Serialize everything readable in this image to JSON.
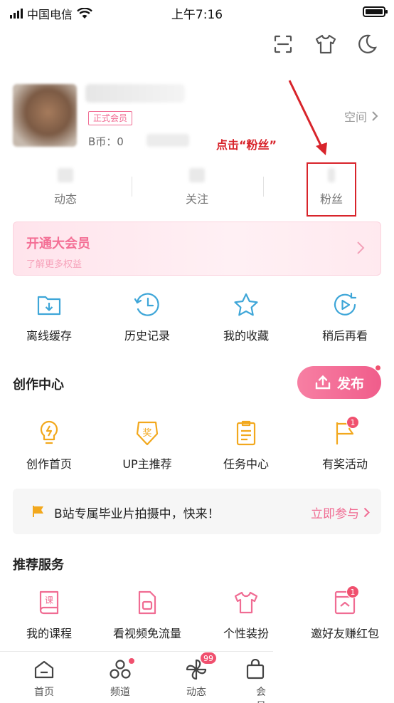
{
  "status_bar": {
    "carrier": "中国电信",
    "time": "上午7:16"
  },
  "profile": {
    "member_badge": "正式会员",
    "bcoin": "B币：0",
    "space_link": "空间"
  },
  "annotation": "点击“粉丝”",
  "stats": [
    {
      "label": "动态"
    },
    {
      "label": "关注"
    },
    {
      "label": "粉丝"
    }
  ],
  "vip": {
    "title": "开通大会员",
    "subtitle": "了解更多权益"
  },
  "quick_actions": [
    {
      "label": "离线缓存",
      "icon": "download-folder-icon"
    },
    {
      "label": "历史记录",
      "icon": "history-clock-icon"
    },
    {
      "label": "我的收藏",
      "icon": "star-icon"
    },
    {
      "label": "稍后再看",
      "icon": "watch-later-icon"
    }
  ],
  "creation": {
    "title": "创作中心",
    "publish": "发布",
    "items": [
      {
        "label": "创作首页",
        "icon": "lightbulb-icon"
      },
      {
        "label": "UP主推荐",
        "icon": "award-badge-icon"
      },
      {
        "label": "任务中心",
        "icon": "task-clipboard-icon"
      },
      {
        "label": "有奖活动",
        "icon": "flag-icon",
        "badge": "1"
      }
    ]
  },
  "notice": {
    "text": "B站专属毕业片拍摄中，快来！",
    "link": "立即参与"
  },
  "services": {
    "title": "推荐服务",
    "items": [
      {
        "label": "我的课程",
        "icon": "course-book-icon"
      },
      {
        "label": "看视频免流量",
        "icon": "sim-card-icon"
      },
      {
        "label": "个性装扮",
        "icon": "tshirt-icon"
      },
      {
        "label": "邀好友赚红包",
        "icon": "red-packet-icon",
        "badge": "1"
      }
    ]
  },
  "tabbar": [
    {
      "label": "首页",
      "icon": "home-icon"
    },
    {
      "label": "频道",
      "icon": "channel-icon"
    },
    {
      "label": "动态",
      "icon": "pinwheel-icon",
      "badge": "99"
    },
    {
      "label": "会员",
      "icon": "vip-bag-icon"
    }
  ],
  "colors": {
    "accent": "#f06c93",
    "annotation": "#d8242b"
  }
}
